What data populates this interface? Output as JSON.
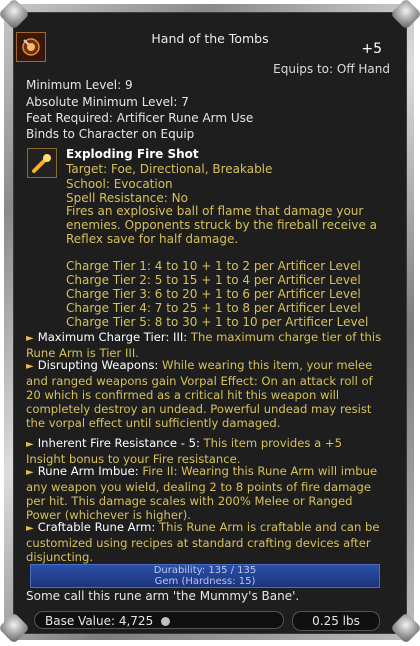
{
  "item": {
    "title": "Hand of the Tombs",
    "enhancement": "+5",
    "equips_to": "Equips to: Off Hand",
    "min_level": "Minimum Level: 9",
    "abs_min_level": "Absolute Minimum Level: 7",
    "feat_required": "Feat Required:  Artificer Rune Arm Use",
    "binds": "Binds to Character on Equip"
  },
  "spell": {
    "name": "Exploding Fire Shot",
    "target": "Target: Foe, Directional, Breakable",
    "school": "School: Evocation",
    "resistance": "Spell Resistance: No",
    "description": "Fires an explosive ball of flame that damage your enemies. Opponents struck by the fireball receive a Reflex save for half damage.",
    "tiers": [
      "Charge Tier 1: 4 to 10 + 1 to 2 per Artificer Level",
      "Charge Tier 2: 5 to 15 + 1 to 4 per Artificer Level",
      "Charge Tier 3: 6 to 20 + 1 to 6 per Artificer Level",
      "Charge Tier 4: 7 to 25 + 1 to 8 per Artificer Level",
      "Charge Tier 5: 8 to 30 + 1 to 10 per Artificer Level"
    ]
  },
  "effects": [
    {
      "name": "Maximum Charge Tier: III:",
      "text": " The maximum charge tier of this Rune Arm is Tier III."
    },
    {
      "name": "Disrupting Weapons:",
      "text": " While wearing this item, your melee and ranged weapons gain Vorpal Effect: On an attack roll of 20 which is confirmed as a critical hit this weapon will completely destroy an undead. Powerful undead may resist the vorpal effect until sufficiently damaged."
    },
    {
      "name": "Inherent Fire Resistance - 5:",
      "text": " This item provides a +5 Insight bonus to your Fire resistance."
    },
    {
      "name": "Rune Arm Imbue:",
      "text": " Fire II: Wearing this Rune Arm will imbue any weapon you wield, dealing 2 to 8 points of fire damage per hit. This damage scales with 200% Melee or Ranged Power (whichever is higher)."
    },
    {
      "name": "Craftable Rune Arm:",
      "text": " This Rune Arm is craftable and can be customized using recipes at standard crafting devices after disjuncting."
    }
  ],
  "durability": "Durability: 135 / 135",
  "gem": "Gem (Hardness: 15)",
  "flavor": "Some call this rune arm 'the Mummy's Bane'.",
  "value": "Base Value:  4,725",
  "weight": "0.25 lbs",
  "colors": {
    "accent": "#d7c05b",
    "frame": "#8a8a8a",
    "bar": "#2c4fa8"
  }
}
